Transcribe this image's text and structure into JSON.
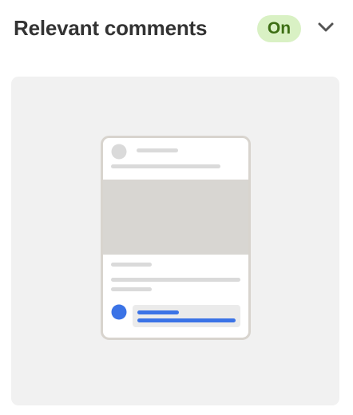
{
  "header": {
    "title": "Relevant comments",
    "status": "On",
    "expand_icon": "chevron-down-icon"
  },
  "colors": {
    "title_text": "#333333",
    "badge_bg": "#d9f1c4",
    "badge_text": "#3c6e13",
    "card_bg": "#f1f1f1",
    "phone_border": "#d8d4ce",
    "placeholder_gray": "#d9d9d9",
    "image_block": "#d8d6d2",
    "accent_blue": "#3b73e6"
  },
  "preview": {
    "illustration_icon": "phone-comment-preview-icon"
  }
}
